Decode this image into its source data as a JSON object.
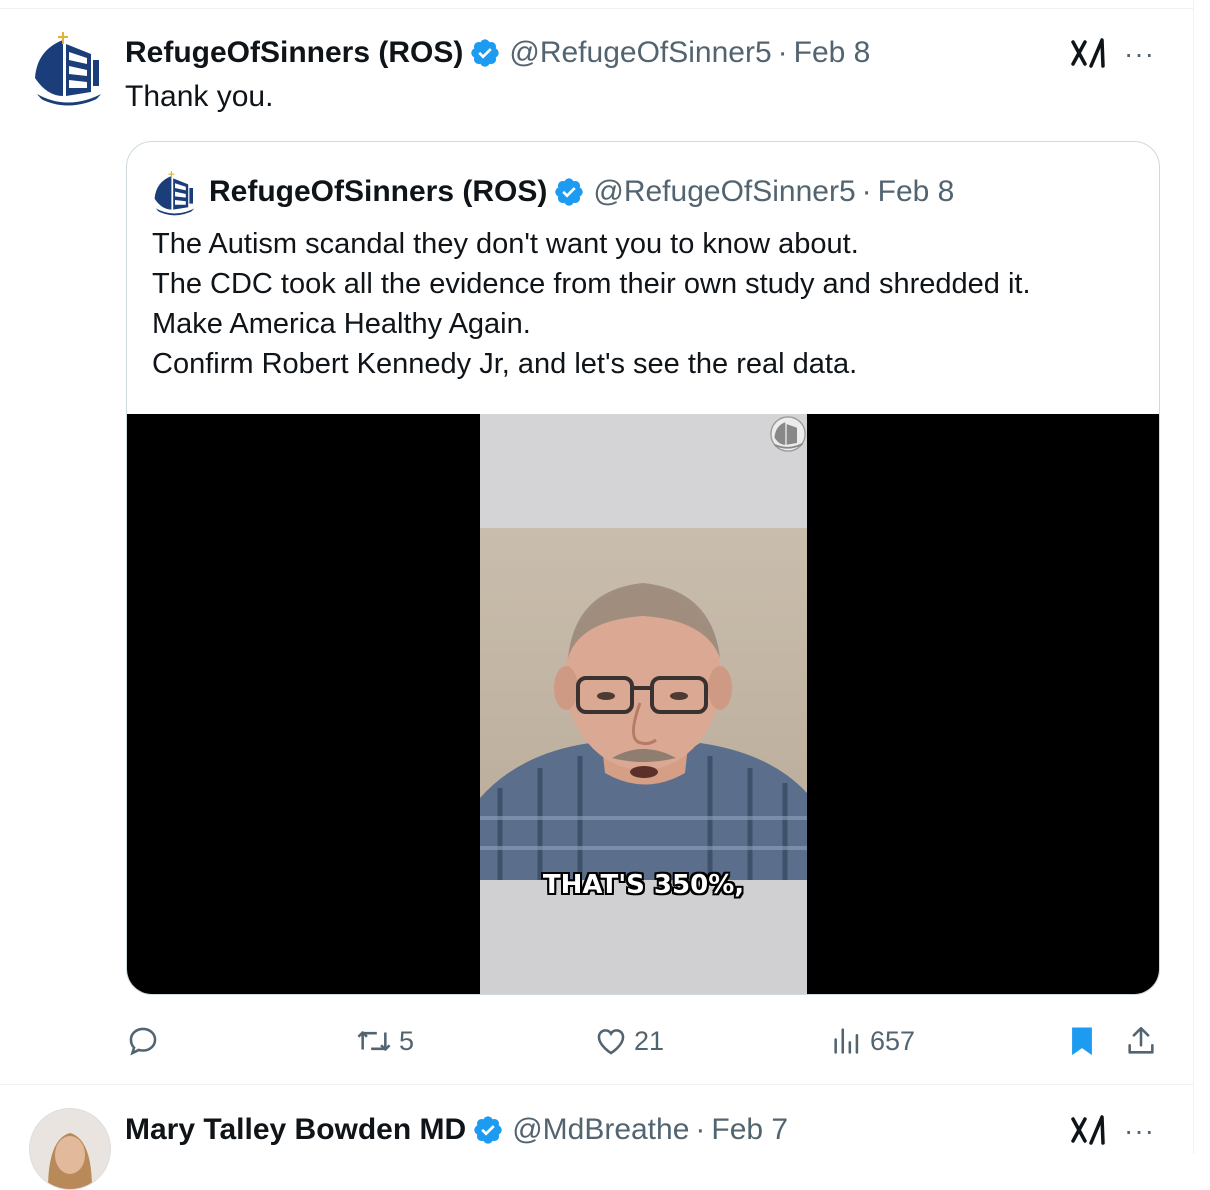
{
  "tweet": {
    "name": "RefugeOfSinners (ROS)",
    "handle": "@RefugeOfSinner5",
    "separator": "·",
    "date": "Feb 8",
    "text": "Thank you.",
    "more_label": "···"
  },
  "quote": {
    "name": "RefugeOfSinners (ROS)",
    "handle": "@RefugeOfSinner5",
    "separator": "·",
    "date": "Feb 8",
    "lines": [
      "The Autism scandal they don't want you to know about.",
      "The CDC took all the evidence from their own study and shredded it.",
      "Make America Healthy Again.",
      "Confirm Robert Kennedy Jr, and let's see the real data."
    ],
    "video_caption": "THAT'S 350%,"
  },
  "actions": {
    "reply_count": "",
    "retweet_count": "5",
    "like_count": "21",
    "views_count": "657"
  },
  "tweet2": {
    "name": "Mary Talley Bowden MD",
    "handle": "@MdBreathe",
    "separator": "·",
    "date": "Feb 7",
    "more_label": "···"
  },
  "colors": {
    "verified_blue": "#1d9bf0",
    "secondary_text": "#536471",
    "bookmark_active": "#1d9bf0",
    "border": "#cfd9de"
  },
  "icons": [
    "verified-badge-icon",
    "grok-icon",
    "more-icon",
    "reply-icon",
    "retweet-icon",
    "like-icon",
    "views-icon",
    "bookmark-icon",
    "share-icon"
  ]
}
